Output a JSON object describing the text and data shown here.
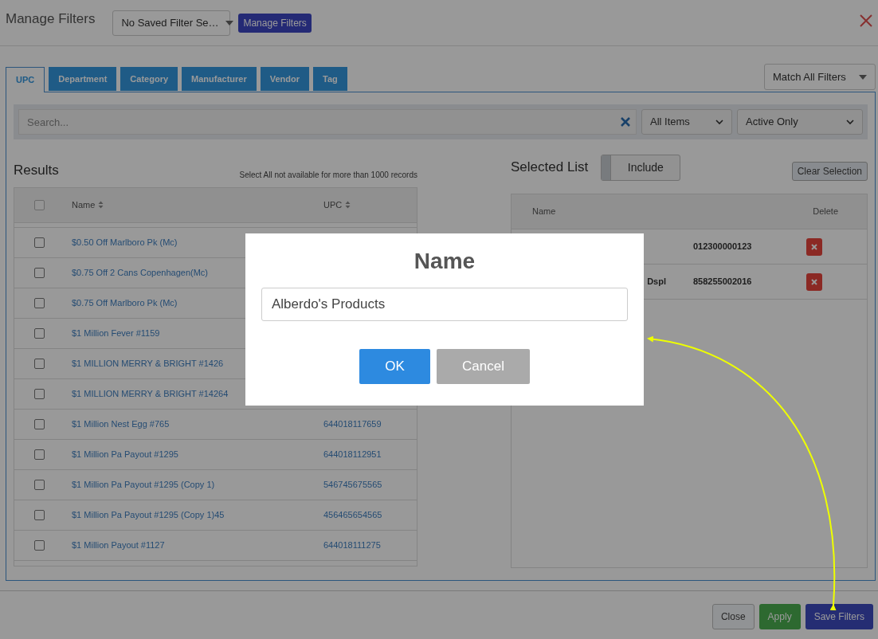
{
  "header": {
    "title": "Manage Filters",
    "saved_filter_select": "No Saved Filter Se…",
    "manage_button": "Manage Filters"
  },
  "tabs": [
    {
      "label": "UPC",
      "selected": true
    },
    {
      "label": "Department",
      "selected": false
    },
    {
      "label": "Category",
      "selected": false
    },
    {
      "label": "Manufacturer",
      "selected": false
    },
    {
      "label": "Vendor",
      "selected": false
    },
    {
      "label": "Tag",
      "selected": false
    }
  ],
  "match_select": "Match All Filters",
  "search": {
    "placeholder": "Search..."
  },
  "item_filter": "All Items",
  "status_filter": "Active Only",
  "results": {
    "title": "Results",
    "note": "Select All not available for more than 1000 records",
    "select_all": {
      "checked": false
    },
    "columns": [
      "Name",
      "UPC"
    ],
    "rows": [
      {
        "name": "$0.50 Off Marlboro Pk (Mc)",
        "checked": false
      },
      {
        "name": "$0.75 Off 2 Cans Copenhagen(Mc)",
        "checked": false
      },
      {
        "name": "$0.75 Off Marlboro Pk (Mc)",
        "checked": false
      },
      {
        "name": "$1 Million Fever #1159",
        "checked": false
      },
      {
        "name": "$1 MILLION MERRY & BRIGHT #1426",
        "checked": false
      },
      {
        "name": "$1 MILLION MERRY & BRIGHT #14264",
        "checked": false
      },
      {
        "name": "$1 Million Nest Egg #765",
        "upc": "644018117659",
        "checked": false
      },
      {
        "name": "$1 Million Pa Payout #1295",
        "upc": "644018112951",
        "checked": false
      },
      {
        "name": "$1 Million Pa Payout #1295 (Copy 1)",
        "upc": "546745675565",
        "checked": false
      },
      {
        "name": "$1 Million Pa Payout #1295 (Copy 1)45",
        "upc": "456465654565",
        "checked": false
      },
      {
        "name": "$1 Million Payout #1127",
        "upc": "644018111275",
        "checked": false
      }
    ]
  },
  "selected_list": {
    "title": "Selected List",
    "mode": "Include",
    "clear_button": "Clear Selection",
    "columns": [
      "Name",
      "Delete"
    ],
    "rows": [
      {
        "upc": "012300000123"
      },
      {
        "name": "Dspl",
        "upc": "858255002016"
      }
    ]
  },
  "footer": {
    "buttons": [
      {
        "label": "Close",
        "kind": "secondary"
      },
      {
        "label": "Apply",
        "kind": "success"
      },
      {
        "label": "Save Filters",
        "kind": "primary"
      }
    ]
  },
  "dialog": {
    "title": "Name",
    "value": "Alberdo's Products",
    "buttons": [
      {
        "label": "OK",
        "kind": "primary"
      },
      {
        "label": "Cancel",
        "kind": "secondary"
      }
    ]
  }
}
